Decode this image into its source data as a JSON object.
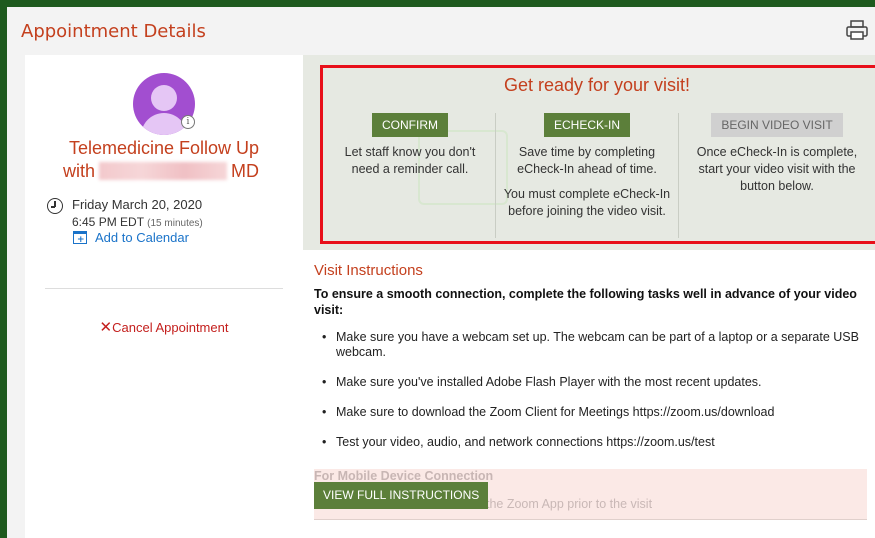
{
  "header": {
    "title": "Appointment Details"
  },
  "appointment": {
    "visit_type": "Telemedicine Follow Up",
    "with_prefix": "with",
    "provider_suffix": "MD",
    "date": "Friday March 20, 2020",
    "time": "6:45 PM EDT",
    "duration": "(15 minutes)",
    "add_to_calendar": "Add to Calendar",
    "cancel_label": "Cancel Appointment"
  },
  "ready": {
    "title": "Get ready for your visit!",
    "steps": [
      {
        "button": "CONFIRM",
        "text": "Let staff know you don't need a reminder call."
      },
      {
        "button": "ECHECK-IN",
        "text": "Save time by completing eCheck-In ahead of time.",
        "text2": "You must complete eCheck-In before joining the video visit."
      },
      {
        "button": "BEGIN VIDEO VISIT",
        "text": "Once eCheck-In is complete, start your video visit with the button below."
      }
    ]
  },
  "instructions": {
    "title": "Visit Instructions",
    "lead": "To ensure a smooth connection, complete the following tasks well in advance of your video visit:",
    "items": [
      "Make sure you have a webcam set up. The webcam can be part of a laptop or a separate USB webcam.",
      "Make sure you've installed Adobe Flash Player with the most recent updates.",
      "Make sure to download the Zoom Client for Meetings https://zoom.us/download",
      "Test your video, audio, and network connections https://zoom.us/test"
    ],
    "mobile_title": "For Mobile Device Connection",
    "mobile_text": "the Zoom App prior to the visit",
    "view_full": "VIEW FULL INSTRUCTIONS"
  },
  "colors": {
    "accent": "#c4401e",
    "button_green": "#5c7f3a",
    "highlight_border": "#e8101a",
    "link_blue": "#1a73c9",
    "frame_green": "#1e5a1e"
  },
  "icons": {
    "print": "printer-icon",
    "clock": "clock-icon",
    "calendar": "calendar-add-icon",
    "cancel": "close-icon",
    "avatar": "user-avatar-icon",
    "info": "info-icon"
  }
}
